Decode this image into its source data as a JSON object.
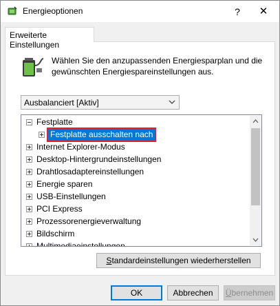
{
  "window": {
    "title": "Energieoptionen",
    "help_label": "?",
    "close_label": "✕"
  },
  "tab": {
    "label": "Erweiterte Einstellungen"
  },
  "description": {
    "line1": "Wählen Sie den anzupassenden Energiesparplan und die",
    "line2": "gewünschten Energiespareinstellungen aus."
  },
  "plan_select": {
    "value": "Ausbalanciert [Aktiv]"
  },
  "tree": {
    "items": [
      {
        "label": "Festplatte",
        "expanded": true,
        "level": 0
      },
      {
        "label": "Festplatte ausschalten nach",
        "expanded": false,
        "level": 1,
        "selected": true
      },
      {
        "label": "Internet Explorer-Modus",
        "expanded": false,
        "level": 0
      },
      {
        "label": "Desktop-Hintergrundeinstellungen",
        "expanded": false,
        "level": 0
      },
      {
        "label": "Drahtlosadaptereinstellungen",
        "expanded": false,
        "level": 0
      },
      {
        "label": "Energie sparen",
        "expanded": false,
        "level": 0
      },
      {
        "label": "USB-Einstellungen",
        "expanded": false,
        "level": 0
      },
      {
        "label": "PCI Express",
        "expanded": false,
        "level": 0
      },
      {
        "label": "Prozessorenergieverwaltung",
        "expanded": false,
        "level": 0
      },
      {
        "label": "Bildschirm",
        "expanded": false,
        "level": 0
      },
      {
        "label": "Multimediaeinstellungen",
        "expanded": false,
        "level": 0
      }
    ]
  },
  "buttons": {
    "restore": {
      "mnemonic": "S",
      "rest": "tandardeinstellungen wiederherstellen"
    },
    "ok": "OK",
    "cancel": "Abbrechen",
    "apply": {
      "mnemonic": "Ü",
      "rest": "bernehmen"
    }
  },
  "colors": {
    "selection": "#0078d7",
    "highlight_border": "#e0202a"
  },
  "icons": {
    "title": "power-options-icon",
    "panel": "battery-power-icon"
  }
}
